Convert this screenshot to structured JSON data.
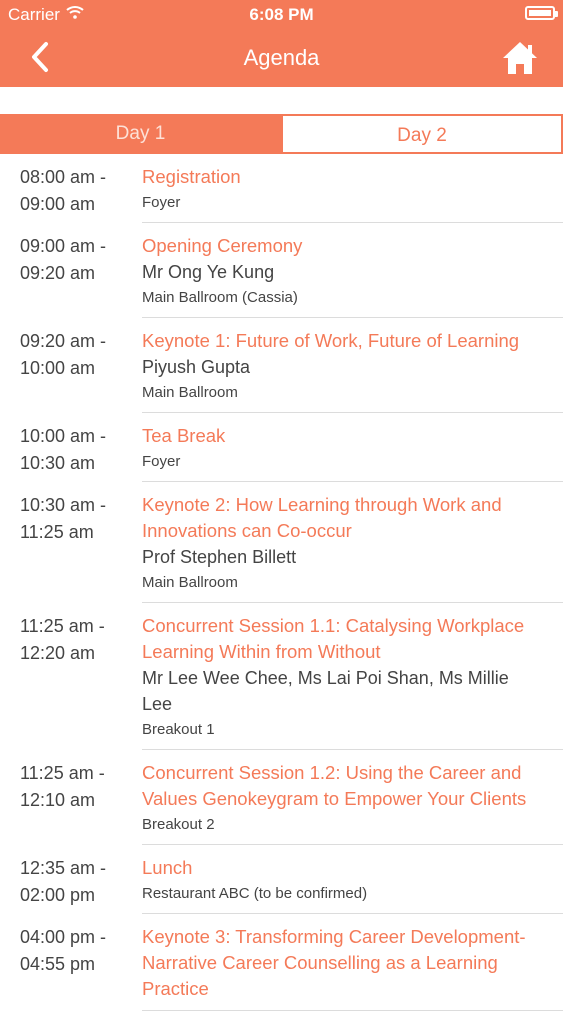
{
  "status_bar": {
    "carrier": "Carrier",
    "time": "6:08 PM"
  },
  "nav": {
    "title": "Agenda"
  },
  "tabs": [
    {
      "label": "Day 1"
    },
    {
      "label": "Day 2"
    }
  ],
  "agenda": [
    {
      "start": "08:00 am -",
      "end": "09:00 am",
      "title": "Registration",
      "speaker": "",
      "venue": "Foyer"
    },
    {
      "start": "09:00 am -",
      "end": "09:20 am",
      "title": "Opening Ceremony",
      "speaker": "Mr Ong Ye Kung",
      "venue": "Main Ballroom (Cassia)"
    },
    {
      "start": "09:20 am -",
      "end": "10:00 am",
      "title": "Keynote 1: Future of Work, Future of Learning",
      "speaker": "Piyush Gupta",
      "venue": "Main Ballroom"
    },
    {
      "start": "10:00 am -",
      "end": "10:30 am",
      "title": "Tea Break",
      "speaker": "",
      "venue": "Foyer"
    },
    {
      "start": "10:30 am -",
      "end": "11:25 am",
      "title": "Keynote 2: How Learning through Work and Innovations can Co-occur",
      "speaker": "Prof Stephen Billett",
      "venue": "Main Ballroom"
    },
    {
      "start": "11:25 am -",
      "end": "12:20 am",
      "title": "Concurrent Session 1.1: Catalysing Workplace Learning Within from Without",
      "speaker": "Mr Lee Wee Chee, Ms Lai Poi Shan, Ms Millie Lee",
      "venue": "Breakout 1"
    },
    {
      "start": "11:25 am -",
      "end": "12:10 am",
      "title": "Concurrent Session 1.2: Using the Career and Values Genokeygram to Empower Your Clients",
      "speaker": "",
      "venue": "Breakout 2"
    },
    {
      "start": "12:35 am -",
      "end": "02:00 pm",
      "title": "Lunch",
      "speaker": "",
      "venue": "Restaurant ABC (to be confirmed)"
    },
    {
      "start": "04:00 pm -",
      "end": "04:55 pm",
      "title": "Keynote 3: Transforming Career Development- Narrative Career Counselling as a Learning Practice",
      "speaker": "",
      "venue": ""
    }
  ],
  "colors": {
    "accent": "#f47a58",
    "text": "#444444",
    "divider": "#dcdcdc"
  }
}
